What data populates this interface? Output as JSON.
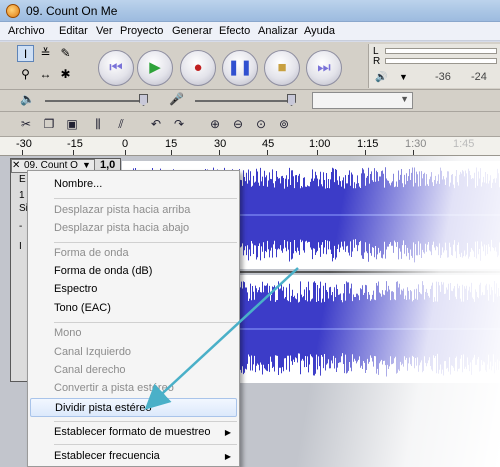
{
  "window": {
    "title": "09. Count On Me"
  },
  "menu": [
    "Archivo",
    "Editar",
    "Ver",
    "Proyecto",
    "Generar",
    "Efecto",
    "Analizar",
    "Ayuda"
  ],
  "meter": {
    "channel_l": "L",
    "channel_r": "R",
    "scale": [
      "-36",
      "-24"
    ]
  },
  "ruler": [
    "-30",
    "-15",
    "0",
    "15",
    "30",
    "45",
    "1:00",
    "1:15",
    "1:30",
    "1:45"
  ],
  "track": {
    "name": "09. Count O",
    "rate_partial": "1,0",
    "panel_fragments": [
      "E",
      "1",
      "Si",
      "-",
      "I"
    ]
  },
  "context_menu": {
    "items": [
      {
        "label": "Nombre...",
        "enabled": true
      },
      {
        "label": "Desplazar pista hacia arriba",
        "enabled": false
      },
      {
        "label": "Desplazar pista hacia abajo",
        "enabled": false
      },
      {
        "label": "Forma de onda",
        "enabled": false
      },
      {
        "label": "Forma de onda (dB)",
        "enabled": true
      },
      {
        "label": "Espectro",
        "enabled": true
      },
      {
        "label": "Tono (EAC)",
        "enabled": true
      },
      {
        "label": "Mono",
        "enabled": false
      },
      {
        "label": "Canal Izquierdo",
        "enabled": false
      },
      {
        "label": "Canal derecho",
        "enabled": false
      },
      {
        "label": "Convertir a pista estéreo",
        "enabled": false
      },
      {
        "label": "Dividir pista estéreo",
        "enabled": true,
        "highlighted": true
      },
      {
        "label": "Establecer formato de muestreo",
        "enabled": true,
        "submenu": true
      },
      {
        "label": "Establecer frecuencia",
        "enabled": true,
        "submenu": true
      }
    ]
  },
  "colors": {
    "waveform": "#3c3cc8",
    "annotation_arrow": "#4ab0c8",
    "highlight": "#dce9fb"
  }
}
